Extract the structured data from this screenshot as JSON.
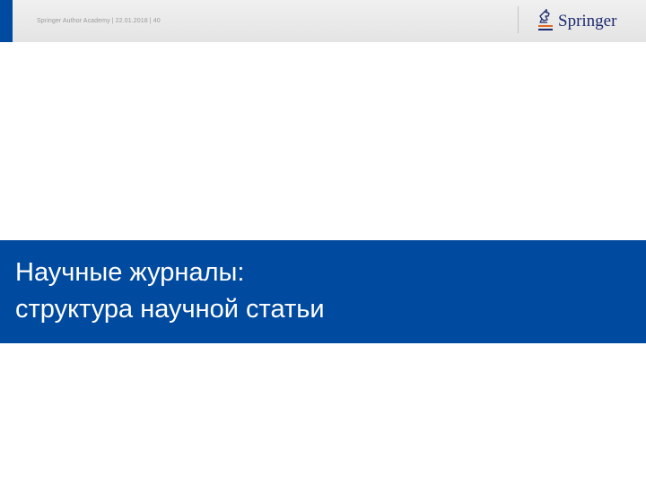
{
  "header": {
    "footer_text": "Springer Author Academy | 22.01.2018 | 40",
    "logo_text": "Springer",
    "logo_icon": "springer-horse-logo"
  },
  "slide": {
    "title_lines": [
      "Научные журналы:",
      "структура научной статьи"
    ]
  },
  "colors": {
    "brand_blue": "#004a9f",
    "header_gray": "#e8e8e8",
    "logo_text": "#1d2a6e",
    "logo_accent": "#e2661f",
    "title_text": "#ffffff"
  }
}
